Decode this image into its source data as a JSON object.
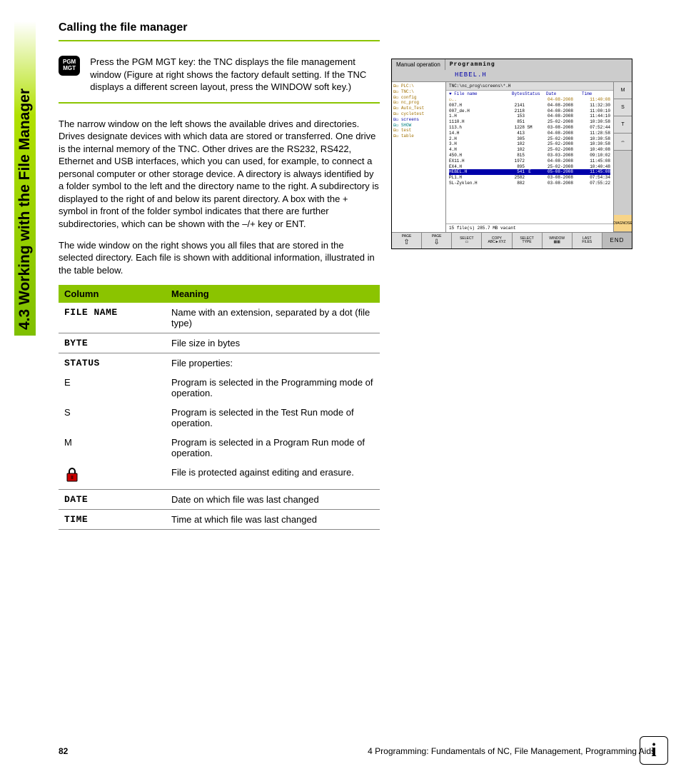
{
  "sidebar_title": "4.3 Working with the File Manager",
  "section_title": "Calling the file manager",
  "key": {
    "line1": "PGM",
    "line2": "MGT"
  },
  "key_text": "Press the PGM MGT key: the TNC displays the file management window (Figure at right shows the factory default setting. If the TNC displays a different screen layout, press the WINDOW soft key.)",
  "para1": "The narrow window on the left shows the available drives and directories. Drives designate devices with which data are stored or transferred. One drive is the internal memory of the TNC. Other drives are the RS232, RS422, Ethernet and USB interfaces, which you can used, for example, to connect a personal computer or other storage device. A directory is always identified by a folder symbol to the left and the directory name to the right. A subdirectory is displayed to the right of and below its parent directory. A box with the + symbol in front of the folder symbol indicates that there are further subdirectories, which can be shown with the –/+ key or ENT.",
  "para2": "The wide window on the right shows you all files that are stored in the selected directory. Each file is shown with additional information, illustrated in the table below.",
  "table": {
    "head": [
      "Column",
      "Meaning"
    ],
    "rows": [
      {
        "c1": "FILE NAME",
        "c2": "Name with an extension, separated by a dot (file type)",
        "mono": true,
        "border": true
      },
      {
        "c1": "BYTE",
        "c2": "File size in bytes",
        "mono": true,
        "border": true
      },
      {
        "c1": "STATUS",
        "c2": "File properties:",
        "mono": true,
        "border": false
      },
      {
        "c1": "E",
        "c2": "Program is selected in the Programming mode of operation.",
        "mono": false,
        "border": false
      },
      {
        "c1": "S",
        "c2": "Program is selected in the Test Run mode of operation.",
        "mono": false,
        "border": false
      },
      {
        "c1": "M",
        "c2": "Program is selected in a Program Run mode of operation.",
        "mono": false,
        "border": false
      },
      {
        "c1": "__LOCK__",
        "c2": "File is protected against editing and erasure.",
        "mono": false,
        "border": true
      },
      {
        "c1": "DATE",
        "c2": "Date on which file was last changed",
        "mono": true,
        "border": true
      },
      {
        "c1": "TIME",
        "c2": "Time at which file was last changed",
        "mono": true,
        "border": true
      }
    ]
  },
  "figure": {
    "mode_left": "Manual operation",
    "mode_right": "Programming",
    "subtitle": "HEBEL.H",
    "path": "TNC:\\nc_prog\\screens\\*.H",
    "tree": [
      {
        "t": "⊟▭ PLC:\\",
        "cls": ""
      },
      {
        "t": "⊟▭ TNC:\\",
        "cls": ""
      },
      {
        "t": " ⊟▭ config",
        "cls": ""
      },
      {
        "t": " ⊟▭ nc_prog",
        "cls": ""
      },
      {
        "t": "  ⊟▭ Auto_Test",
        "cls": ""
      },
      {
        "t": "  ⊟▭ cycletest",
        "cls": ""
      },
      {
        "t": "  ⊟▭ screens",
        "cls": "blue"
      },
      {
        "t": "  ⊟▭ SHOW",
        "cls": "teal"
      },
      {
        "t": "  ⊟▭ test",
        "cls": ""
      },
      {
        "t": " ⊟▭ table",
        "cls": ""
      }
    ],
    "cols": [
      "♥ File name",
      "Bytes",
      "Status",
      "Date",
      "Time"
    ],
    "files": [
      {
        "n": "▭..",
        "b": "",
        "s": "",
        "d": "04-08-2008",
        "t": "11:40:08",
        "cls": "topdir"
      },
      {
        "n": "007.H",
        "b": "2141",
        "s": "",
        "d": "04-08-2008",
        "t": "11:32:30"
      },
      {
        "n": "007_de.H",
        "b": "2118",
        "s": "",
        "d": "04-08-2008",
        "t": "11:00:10"
      },
      {
        "n": "1.H",
        "b": "153",
        "s": "",
        "d": "04-08-2008",
        "t": "11:44:10"
      },
      {
        "n": "1110.H",
        "b": "851",
        "s": "",
        "d": "25-02-2008",
        "t": "10:30:58"
      },
      {
        "n": "113.h",
        "b": "1228",
        "s": "SM",
        "d": "03-08-2008",
        "t": "07:52:44"
      },
      {
        "n": "14.H",
        "b": "413",
        "s": "",
        "d": "04-08-2008",
        "t": "11:28:58"
      },
      {
        "n": "2.H",
        "b": "305",
        "s": "",
        "d": "25-02-2008",
        "t": "10:30:58"
      },
      {
        "n": "3.H",
        "b": "102",
        "s": "",
        "d": "25-02-2008",
        "t": "10:30:58"
      },
      {
        "n": "4.H",
        "b": "102",
        "s": "",
        "d": "25-02-2008",
        "t": "10:40:08"
      },
      {
        "n": "450.H",
        "b": "815",
        "s": "",
        "d": "03-03-2008",
        "t": "09:10:02"
      },
      {
        "n": "EX11.H",
        "b": "1972",
        "s": "",
        "d": "04-08-2008",
        "t": "11:45:08"
      },
      {
        "n": "EX4.H",
        "b": "895",
        "s": "",
        "d": "25-02-2008",
        "t": "10:40:48"
      },
      {
        "n": "HEBEL.H",
        "b": "541",
        "s": "E",
        "d": "05-08-2008",
        "t": "11:45:08",
        "cls": "selected"
      },
      {
        "n": "PL1.H",
        "b": "2582",
        "s": "",
        "d": "03-08-2008",
        "t": "07:54:34"
      },
      {
        "n": "SL-Zyklen.H",
        "b": "882",
        "s": "",
        "d": "03-08-2008",
        "t": "07:55:22"
      }
    ],
    "status": "15  file(s)  285.7 MB vacant",
    "rbar": [
      "M",
      "S",
      "T",
      "⇔",
      "DIAGNOSE"
    ],
    "softkeys": [
      "PAGE\n⇧",
      "PAGE\n⇩",
      "SELECT\n▭",
      "COPY\nABC►XYZ",
      "SELECT\nTYPE",
      "WINDOW\n▦▦",
      "LAST\nFILES",
      "END"
    ]
  },
  "footer": {
    "page": "82",
    "chapter": "4 Programming: Fundamentals of NC, File Management, Programming Aids"
  },
  "info_badge": "i"
}
